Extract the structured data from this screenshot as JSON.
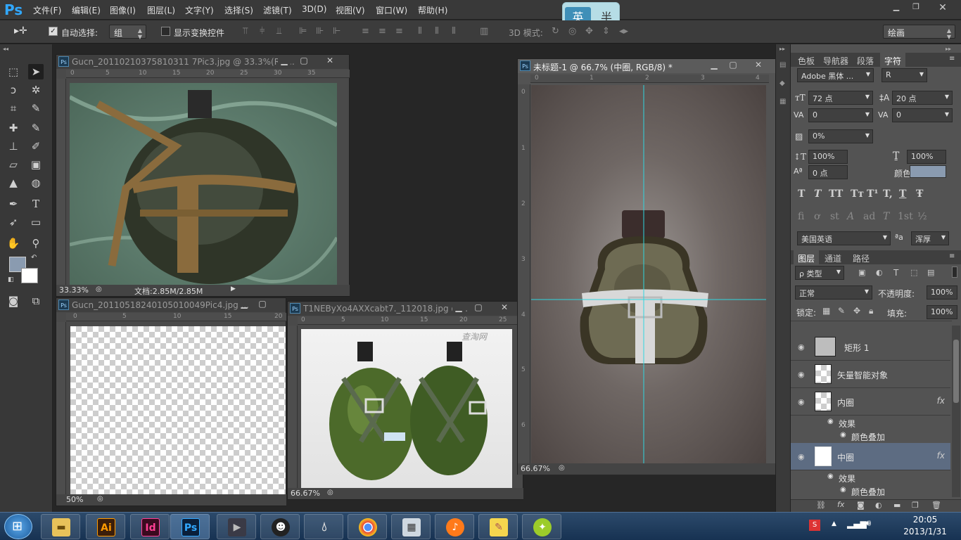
{
  "app": {
    "logo": "Ps"
  },
  "menu": [
    "文件(F)",
    "编辑(E)",
    "图像(I)",
    "图层(L)",
    "文字(Y)",
    "选择(S)",
    "滤镜(T)",
    "3D(D)",
    "视图(V)",
    "窗口(W)",
    "帮助(H)"
  ],
  "ime": {
    "left": "英",
    "right": "半"
  },
  "options": {
    "auto_select_label": "自动选择:",
    "auto_select_value": "组",
    "show_transform_label": "显示变换控件",
    "mode_3d_label": "3D 模式:",
    "workspace_value": "绘画"
  },
  "docs": {
    "d1": {
      "title": "Gucn_20110210375810311 7Pic3.jpg @ 33.3%(RG...",
      "zoom": "33.33%",
      "info": "文档:2.85M/2.85M"
    },
    "d2": {
      "title": "Gucn_20110518240105010049Pic4.jpg ...",
      "zoom": "50%"
    },
    "d3": {
      "title": "T1NEByXo4AXXcabt7._112018.jpg @...",
      "zoom": "66.67%",
      "watermark": "查淘网"
    },
    "d4": {
      "title": "未标题-1 @ 66.7% (中圈, RGB/8) *",
      "zoom": "66.67%"
    }
  },
  "rulers": {
    "d1_h": [
      "0",
      "5",
      "10",
      "15",
      "20",
      "25",
      "30",
      "35"
    ],
    "d2_h": [
      "0",
      "5",
      "10",
      "15",
      "20"
    ],
    "d3_h": [
      "0",
      "5",
      "10",
      "15",
      "20",
      "25"
    ],
    "d4_h": [
      "0",
      "1",
      "2",
      "3",
      "4"
    ],
    "d4_v": [
      "0",
      "1",
      "2",
      "3",
      "4",
      "5",
      "6"
    ]
  },
  "char_panel": {
    "tabs": [
      "色板",
      "导航器",
      "段落",
      "字符"
    ],
    "font_family": "Adobe 黑体 ...",
    "font_style": "R",
    "font_size": "72 点",
    "leading": "20 点",
    "kerning": "0",
    "tracking": "0",
    "scale_pct": "0%",
    "vscale": "100%",
    "hscale": "100%",
    "baseline": "0 点",
    "color_label": "颜色:",
    "color_swatch": "#8a9bb0",
    "language": "美国英语",
    "antialias_icon": "ªa",
    "antialias": "浑厚",
    "style_buttons": [
      "T",
      "T",
      "TT",
      "Tт",
      "T¹",
      "T,",
      "T",
      "Ŧ"
    ],
    "ot_buttons": [
      "fi",
      "ơ",
      "st",
      "A",
      "ad",
      "T",
      "1st",
      "½"
    ]
  },
  "layers_panel": {
    "tabs": [
      "图层",
      "通道",
      "路径"
    ],
    "filter": "ρ 类型",
    "blend_mode": "正常",
    "opacity_label": "不透明度:",
    "opacity": "100%",
    "lock_label": "锁定:",
    "fill_label": "填充:",
    "fill": "100%",
    "layers": [
      {
        "name": "矩形 1",
        "fx": ""
      },
      {
        "name": "矢量智能对象",
        "fx": ""
      },
      {
        "name": "内圈",
        "fx": "fx"
      },
      {
        "name": "中圈",
        "fx": "fx"
      }
    ],
    "effects_label": "效果",
    "color_overlay": "颜色叠加"
  },
  "taskbar": {
    "apps": [
      "Ai",
      "Id",
      "Ps"
    ],
    "time": "20:05",
    "date": "2013/1/31"
  }
}
